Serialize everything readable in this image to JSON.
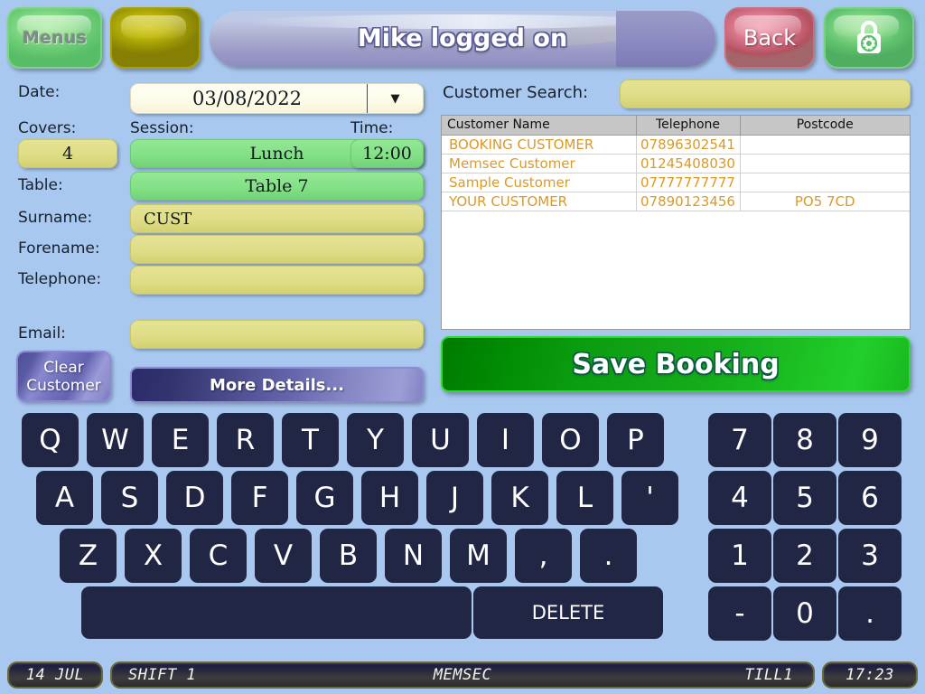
{
  "header": {
    "menus_label": "Menus",
    "title": "Mike logged on",
    "back_label": "Back",
    "lock_icon": "padlock-icon",
    "yellow_icon": "blank-button"
  },
  "form": {
    "date_label": "Date:",
    "date_value": "03/08/2022",
    "date_dropdown_icon": "chevron-down-icon",
    "covers_label": "Covers:",
    "covers_value": "4",
    "session_label": "Session:",
    "session_value": "Lunch",
    "time_label": "Time:",
    "time_value": "12:00",
    "table_label": "Table:",
    "table_value": "Table 7",
    "surname_label": "Surname:",
    "surname_value": "CUST",
    "forename_label": "Forename:",
    "forename_value": "",
    "telephone_label": "Telephone:",
    "telephone_value": "",
    "email_label": "Email:",
    "email_value": "",
    "clear_customer_line1": "Clear",
    "clear_customer_line2": "Customer",
    "more_details_label": "More Details..."
  },
  "customer_panel": {
    "search_label": "Customer Search:",
    "search_value": "",
    "columns": [
      "Customer Name",
      "Telephone",
      "Postcode"
    ],
    "rows": [
      {
        "name": "BOOKING CUSTOMER",
        "telephone": "07896302541",
        "postcode": ""
      },
      {
        "name": "Memsec Customer",
        "telephone": "01245408030",
        "postcode": ""
      },
      {
        "name": "Sample Customer",
        "telephone": "07777777777",
        "postcode": ""
      },
      {
        "name": "YOUR CUSTOMER",
        "telephone": "07890123456",
        "postcode": "PO5 7CD"
      }
    ],
    "save_booking_label": "Save Booking"
  },
  "keyboard": {
    "row1": [
      "Q",
      "W",
      "E",
      "R",
      "T",
      "Y",
      "U",
      "I",
      "O",
      "P"
    ],
    "row2": [
      "A",
      "S",
      "D",
      "F",
      "G",
      "H",
      "J",
      "K",
      "L",
      "'"
    ],
    "row3": [
      "Z",
      "X",
      "C",
      "V",
      "B",
      "N",
      "M",
      ",",
      "."
    ],
    "space_label": "",
    "delete_label": "DELETE"
  },
  "numpad": {
    "row1": [
      "7",
      "8",
      "9"
    ],
    "row2": [
      "4",
      "5",
      "6"
    ],
    "row3": [
      "1",
      "2",
      "3"
    ],
    "row4": [
      "-",
      "0",
      "."
    ]
  },
  "statusbar": {
    "date": "14 JUL",
    "shift": "SHIFT 1",
    "company": "MEMSEC",
    "till": "TILL1",
    "time": "17:23"
  },
  "colors": {
    "background": "#a8c8ef",
    "field_yellow": "#dfdd86",
    "field_green": "#84e087",
    "key_navy": "#222645",
    "save_green": "#14ad1a",
    "row_text_orange": "#d99a28",
    "accent_purple": "#6464ab"
  }
}
